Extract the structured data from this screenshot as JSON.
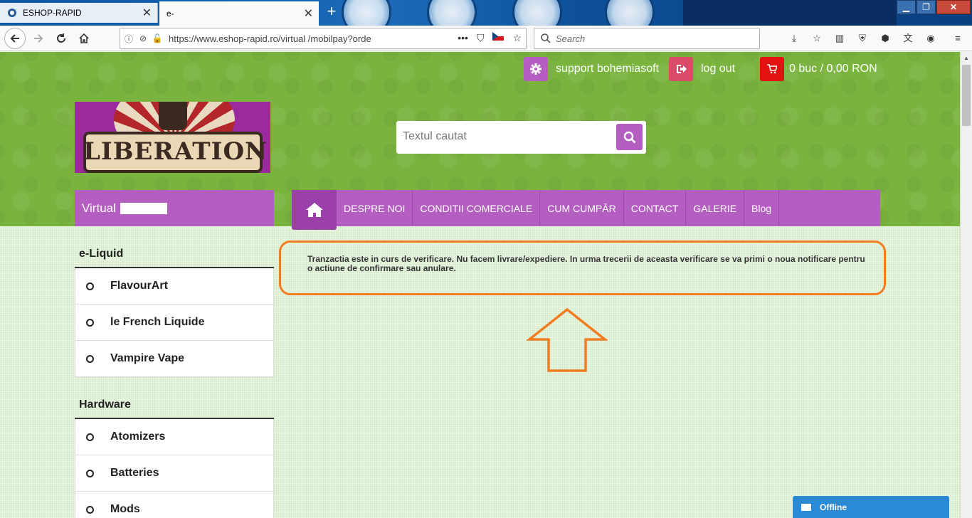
{
  "browser": {
    "tabs": [
      {
        "title": "ESHOP-RAPID",
        "active": false
      },
      {
        "title": "e-",
        "active": true
      }
    ],
    "new_tab_symbol": "+",
    "window_buttons": {
      "minimize": "▁",
      "maximize": "❐",
      "close": "✕"
    },
    "url": "https://www.eshop-rapid.ro/virtual            /mobilpay?orde",
    "url_actions": {
      "more": "•••"
    },
    "search_placeholder": "Search",
    "toolbar_icons": [
      "download-icon",
      "bookmarks-icon",
      "sidebar-icon",
      "ublock-icon",
      "adblock-icon",
      "translate-icon",
      "account-icon",
      "menu-icon"
    ]
  },
  "header": {
    "support_label": "support bohemiasoft",
    "logout_label": "log out",
    "cart_label": "0 buc / 0,00 RON",
    "logo_text": "LIBERATION",
    "search_placeholder": "Textul cautat"
  },
  "category_box": {
    "label": "Virtual"
  },
  "nav": {
    "items": [
      "DESPRE NOI",
      "CONDITII COMERCIALE",
      "CUM CUMPĂR",
      "CONTACT",
      "GALERIE",
      "Blog"
    ]
  },
  "sidebar": {
    "sections": [
      {
        "heading": "e-Liquid",
        "items": [
          "FlavourArt",
          "le French Liquide",
          "Vampire Vape"
        ]
      },
      {
        "heading": "Hardware",
        "items": [
          "Atomizers",
          "Batteries",
          "Mods"
        ]
      }
    ]
  },
  "notice": {
    "text": "Tranzactia este in curs de verificare. Nu facem livrare/expediere. In urma trecerii de aceasta verificare se va primi o noua notificare pentru o actiune de confirmare sau anulare."
  },
  "chat": {
    "label": "Offline"
  },
  "colors": {
    "header_green": "#7ab33e",
    "accent_purple": "#b55ec2",
    "highlight_orange": "#f07d22",
    "cart_red": "#e31212",
    "chat_blue": "#2a8ad6"
  }
}
